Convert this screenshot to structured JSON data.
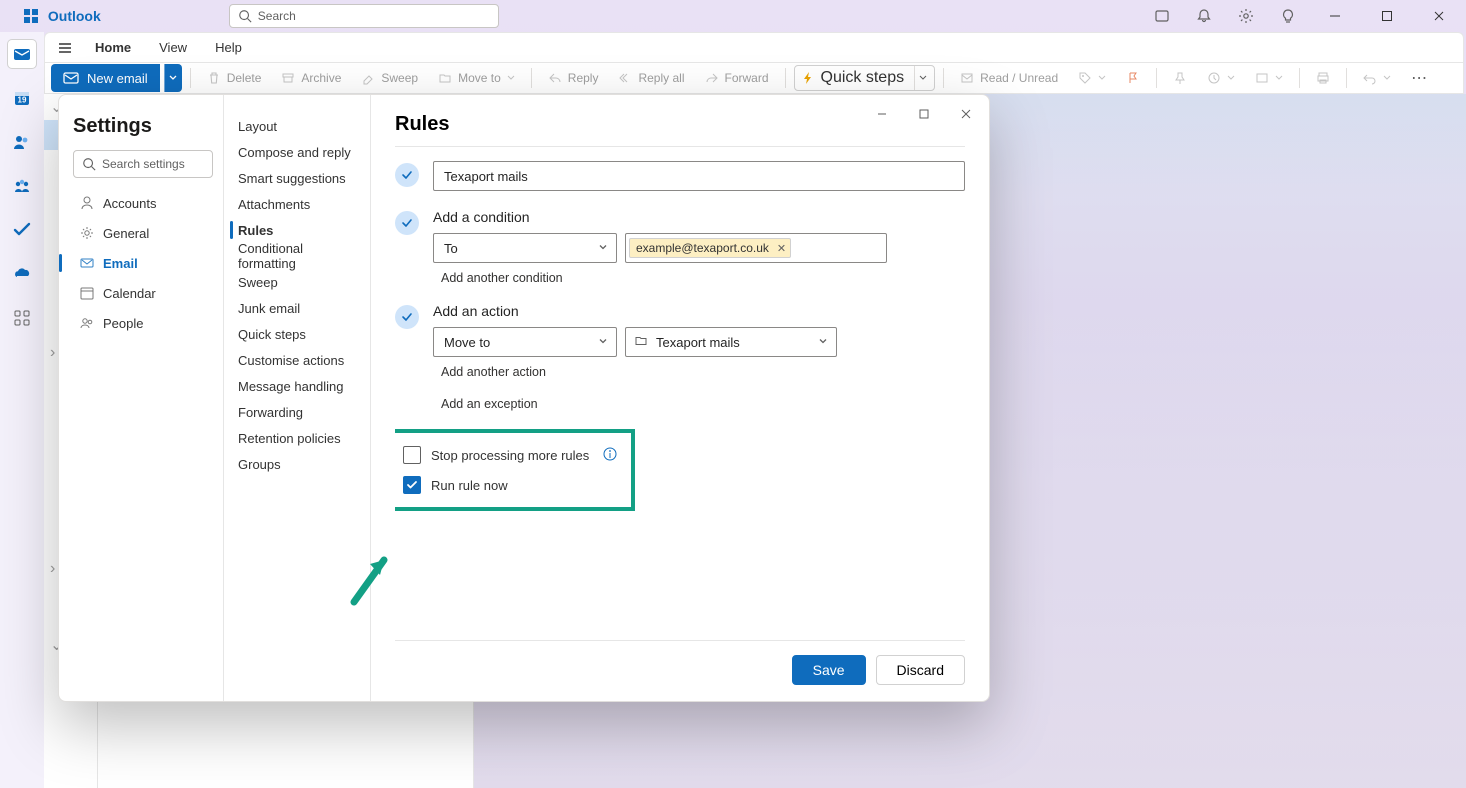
{
  "app": {
    "brand": "Outlook"
  },
  "search": {
    "placeholder": "Search"
  },
  "menubar": {
    "home": "Home",
    "view": "View",
    "help": "Help"
  },
  "ribbon": {
    "newEmail": "New email",
    "delete": "Delete",
    "archive": "Archive",
    "sweep": "Sweep",
    "moveTo": "Move to",
    "reply": "Reply",
    "replyAll": "Reply all",
    "forward": "Forward",
    "quickSteps": "Quick steps",
    "readUnread": "Read / Unread"
  },
  "settings": {
    "title": "Settings",
    "searchPlaceholder": "Search settings",
    "leftNav": {
      "accounts": "Accounts",
      "general": "General",
      "email": "Email",
      "calendar": "Calendar",
      "people": "People"
    },
    "midNav": {
      "layout": "Layout",
      "compose": "Compose and reply",
      "smart": "Smart suggestions",
      "attachments": "Attachments",
      "rules": "Rules",
      "conditional": "Conditional formatting",
      "sweep": "Sweep",
      "junk": "Junk email",
      "quickSteps": "Quick steps",
      "customise": "Customise actions",
      "messageHandling": "Message handling",
      "forwarding": "Forwarding",
      "retention": "Retention policies",
      "groups": "Groups"
    },
    "detail": {
      "heading": "Rules",
      "ruleName": "Texaport mails",
      "condition": {
        "label": "Add a condition",
        "field": "To",
        "chip": "example@texaport.co.uk",
        "addAnother": "Add another condition"
      },
      "action": {
        "label": "Add an action",
        "field": "Move to",
        "target": "Texaport mails",
        "addAnother": "Add another action",
        "addException": "Add an exception"
      },
      "checks": {
        "stop": "Stop processing more rules",
        "run": "Run rule now"
      },
      "save": "Save",
      "discard": "Discard"
    }
  }
}
